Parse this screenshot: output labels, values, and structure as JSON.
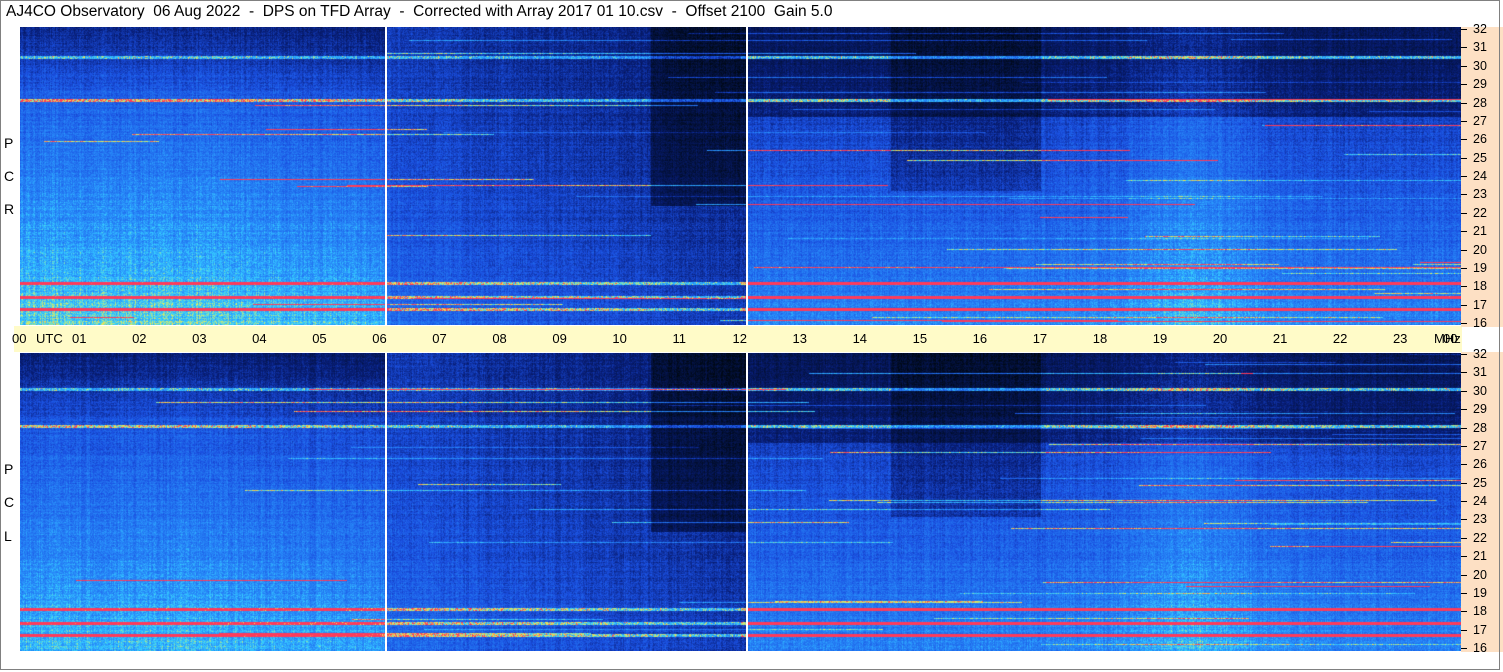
{
  "title": "AJ4CO Observatory  06 Aug 2022  -  DPS on TFD Array  -  Corrected with Array 2017 01 10.csv  -  Offset 2100  Gain 5.0",
  "chart_data": {
    "type": "heatmap",
    "panels": [
      {
        "name": "RCP",
        "label_letters": [
          "P",
          "C",
          "R"
        ]
      },
      {
        "name": "LCP",
        "label_letters": [
          "P",
          "C",
          "L"
        ]
      }
    ],
    "x_unit_label": "UTC",
    "x_ticks": [
      "00",
      "01",
      "02",
      "03",
      "04",
      "05",
      "06",
      "07",
      "08",
      "09",
      "10",
      "11",
      "12",
      "13",
      "14",
      "15",
      "16",
      "17",
      "18",
      "19",
      "20",
      "21",
      "22",
      "23",
      "00"
    ],
    "y_unit_label": "MHz",
    "y_ticks": [
      "32",
      "31",
      "30",
      "29",
      "28",
      "27",
      "26",
      "25",
      "24",
      "23",
      "22",
      "21",
      "20",
      "19",
      "18",
      "17",
      "16"
    ],
    "ylim": [
      16,
      32
    ],
    "xlim_hours": [
      0,
      24
    ],
    "markers_utc_hours": [
      6.1,
      12.1
    ],
    "colors": {
      "low": "#000814",
      "mid": "#1a4fe0",
      "high": "#36d0ff",
      "peak": "#f7f04a",
      "hot": "#ff3a5a"
    }
  }
}
